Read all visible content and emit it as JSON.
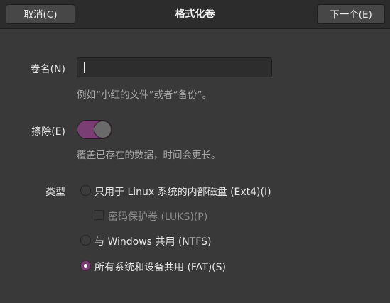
{
  "header": {
    "cancel_label": "取消(C)",
    "title": "格式化卷",
    "next_label": "下一个(E)"
  },
  "volume_name": {
    "label": "卷名(N)",
    "value": "",
    "hint": "例如“小红的文件”或者“备份”。"
  },
  "erase": {
    "label": "擦除(E)",
    "enabled": true,
    "hint": "覆盖已存在的数据，时间会更长。"
  },
  "type": {
    "label": "类型",
    "options": [
      {
        "label": "只用于 Linux 系统的内部磁盘 (Ext4)(I)",
        "selected": false
      },
      {
        "label": "与 Windows 共用 (NTFS)",
        "selected": false
      },
      {
        "label": "所有系统和设备共用 (FAT)(S)",
        "selected": true
      }
    ],
    "password_checkbox": {
      "label": "密码保护卷 (LUKS)(P)",
      "checked": false,
      "disabled": true
    }
  },
  "colors": {
    "accent": "#7a3e74",
    "background": "#393939",
    "header_background": "#2c2c2c"
  }
}
